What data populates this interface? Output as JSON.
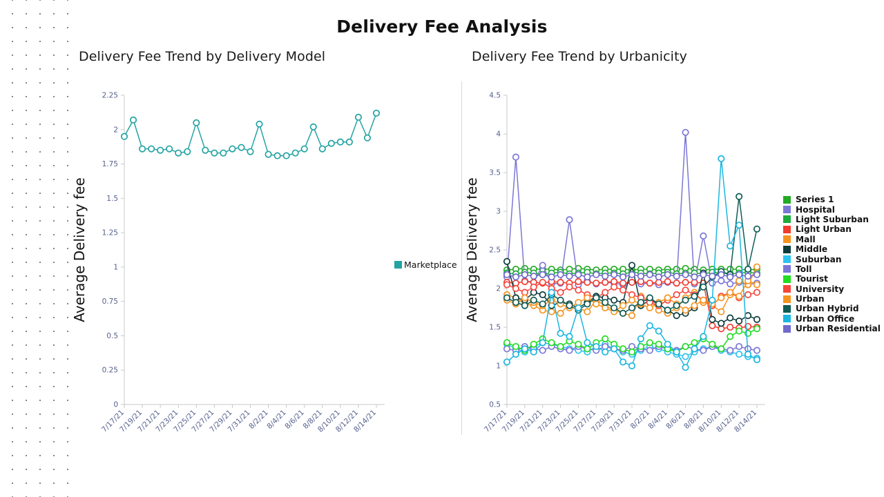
{
  "page": {
    "title": "Delivery Fee Analysis",
    "background": "#ffffff",
    "decoration": "dot-grid-left-margin"
  },
  "panels": {
    "left": {
      "title": "Delivery Fee Trend by Delivery Model",
      "legend_label": "Marketplace",
      "legend_color": "#23a3a3"
    },
    "right": {
      "title": "Delivery Fee Trend by Urbanicity"
    }
  },
  "chart_data": [
    {
      "id": "left",
      "type": "line",
      "title": "Delivery Fee Trend by Delivery Model",
      "xlabel": "",
      "ylabel": "Average Delivery fee",
      "ylim": [
        0,
        2.25
      ],
      "yticks": [
        0,
        0.25,
        0.5,
        0.75,
        1,
        1.25,
        1.5,
        1.75,
        2,
        2.25
      ],
      "ytick_labels": [
        "0",
        "0.25",
        "0.5",
        "0.75",
        "1",
        "1.25",
        "1.5",
        "1.75",
        "2",
        "2.25"
      ],
      "grid": false,
      "legend_position": "right",
      "xtick_labels": [
        "7/17/21",
        "7/19/21",
        "7/21/21",
        "7/23/21",
        "7/25/21",
        "7/27/21",
        "7/29/21",
        "7/31/21",
        "8/2/21",
        "8/4/21",
        "8/6/21",
        "8/8/21",
        "8/10/21",
        "8/12/21",
        "8/14/21"
      ],
      "x": [
        "7/17/21",
        "7/18/21",
        "7/19/21",
        "7/20/21",
        "7/21/21",
        "7/22/21",
        "7/23/21",
        "7/24/21",
        "7/25/21",
        "7/26/21",
        "7/27/21",
        "7/28/21",
        "7/29/21",
        "7/30/21",
        "7/31/21",
        "8/1/21",
        "8/2/21",
        "8/3/21",
        "8/4/21",
        "8/5/21",
        "8/6/21",
        "8/7/21",
        "8/8/21",
        "8/9/21",
        "8/10/21",
        "8/11/21",
        "8/12/21",
        "8/13/21",
        "8/14/21"
      ],
      "series": [
        {
          "name": "Marketplace",
          "color": "#23a3a3",
          "values": [
            1.95,
            2.07,
            1.86,
            1.86,
            1.85,
            1.86,
            1.83,
            1.84,
            2.05,
            1.85,
            1.83,
            1.83,
            1.86,
            1.87,
            1.84,
            2.04,
            1.82,
            1.81,
            1.81,
            1.83,
            1.86,
            2.02,
            1.86,
            1.9,
            1.91,
            1.91,
            2.09,
            1.94,
            2.12
          ]
        }
      ]
    },
    {
      "id": "right",
      "type": "line",
      "title": "Delivery Fee Trend by Urbanicity",
      "xlabel": "",
      "ylabel": "Average Delivery fee",
      "ylim": [
        0.5,
        4.5
      ],
      "yticks": [
        0.5,
        1,
        1.5,
        2,
        2.5,
        3,
        3.5,
        4,
        4.5
      ],
      "ytick_labels": [
        "0.5",
        "1",
        "1.5",
        "2",
        "2.5",
        "3",
        "3.5",
        "4",
        "4.5"
      ],
      "grid": false,
      "legend_position": "right",
      "xtick_labels": [
        "7/17/21",
        "7/19/21",
        "7/21/21",
        "7/23/21",
        "7/25/21",
        "7/27/21",
        "7/29/21",
        "7/31/21",
        "8/2/21",
        "8/4/21",
        "8/6/21",
        "8/8/21",
        "8/10/21",
        "8/12/21",
        "8/14/21"
      ],
      "x": [
        "7/17/21",
        "7/18/21",
        "7/19/21",
        "7/20/21",
        "7/21/21",
        "7/22/21",
        "7/23/21",
        "7/24/21",
        "7/25/21",
        "7/26/21",
        "7/27/21",
        "7/28/21",
        "7/29/21",
        "7/30/21",
        "7/31/21",
        "8/1/21",
        "8/2/21",
        "8/3/21",
        "8/4/21",
        "8/5/21",
        "8/6/21",
        "8/7/21",
        "8/8/21",
        "8/9/21",
        "8/10/21",
        "8/11/21",
        "8/12/21",
        "8/13/21",
        "8/14/21"
      ],
      "series": [
        {
          "name": "Series 1",
          "color": "#22aa22",
          "values": [
            2.24,
            2.25,
            2.26,
            2.25,
            2.25,
            2.25,
            2.24,
            2.25,
            2.26,
            2.25,
            2.24,
            2.25,
            2.25,
            2.25,
            2.24,
            2.25,
            2.25,
            2.24,
            2.25,
            2.25,
            2.26,
            2.25,
            2.24,
            2.25,
            2.25,
            2.25,
            2.25,
            2.24,
            2.25
          ]
        },
        {
          "name": "Hospital",
          "color": "#7b76d6",
          "values": [
            2.15,
            3.7,
            2.1,
            2.08,
            2.3,
            2.06,
            2.07,
            2.89,
            2.05,
            2.1,
            2.06,
            2.08,
            2.07,
            2.05,
            2.08,
            2.06,
            2.07,
            2.05,
            2.08,
            2.07,
            4.02,
            2.06,
            2.68,
            2.07,
            2.1,
            2.06,
            2.08,
            2.05,
            2.07
          ]
        },
        {
          "name": "Light Suburban",
          "color": "#1faa3c",
          "values": [
            2.2,
            2.19,
            2.21,
            2.2,
            2.18,
            2.2,
            2.21,
            2.19,
            2.2,
            2.21,
            2.19,
            2.2,
            2.2,
            2.19,
            2.21,
            2.2,
            2.19,
            2.2,
            2.21,
            2.19,
            2.2,
            2.2,
            2.19,
            2.21,
            2.2,
            2.19,
            2.2,
            2.21,
            2.2
          ]
        },
        {
          "name": "Light Urban",
          "color": "#f33b2e",
          "values": [
            2.08,
            2.07,
            2.09,
            2.08,
            2.07,
            2.09,
            2.08,
            2.07,
            2.09,
            2.08,
            2.07,
            2.08,
            2.09,
            2.07,
            2.08,
            2.09,
            2.07,
            2.08,
            2.09,
            2.07,
            2.08,
            2.08,
            2.07,
            1.52,
            1.48,
            1.5,
            1.49,
            1.51,
            1.5
          ]
        },
        {
          "name": "Mall",
          "color": "#f6931e",
          "values": [
            1.92,
            1.88,
            1.8,
            1.78,
            1.72,
            1.7,
            1.68,
            1.8,
            1.75,
            1.7,
            1.85,
            1.78,
            1.72,
            1.68,
            1.65,
            1.9,
            1.85,
            1.72,
            1.68,
            1.75,
            1.88,
            1.95,
            1.82,
            1.78,
            1.7,
            1.92,
            2.1,
            2.05,
            2.28
          ]
        },
        {
          "name": "Middle",
          "color": "#0d3b3b",
          "values": [
            2.35,
            1.88,
            1.85,
            1.95,
            1.92,
            1.78,
            1.82,
            1.8,
            1.75,
            1.82,
            1.9,
            1.88,
            1.85,
            1.82,
            2.3,
            1.78,
            1.85,
            1.8,
            1.72,
            1.65,
            1.68,
            1.75,
            2.2,
            1.6,
            1.55,
            1.62,
            1.58,
            1.65,
            1.6
          ]
        },
        {
          "name": "Suburban",
          "color": "#2bc3f0",
          "values": [
            1.28,
            1.22,
            1.18,
            1.25,
            1.3,
            1.28,
            1.25,
            1.22,
            1.2,
            1.18,
            1.25,
            1.28,
            1.22,
            1.18,
            1.15,
            1.2,
            1.25,
            1.22,
            1.18,
            1.15,
            1.12,
            1.18,
            1.22,
            1.25,
            1.2,
            1.18,
            1.15,
            1.12,
            1.1
          ]
        },
        {
          "name": "Toll",
          "color": "#7b76d6",
          "values": [
            1.22,
            1.2,
            1.25,
            1.22,
            1.2,
            1.25,
            1.22,
            1.2,
            1.25,
            1.22,
            1.2,
            1.25,
            1.22,
            1.2,
            1.25,
            1.22,
            1.2,
            1.25,
            1.22,
            1.2,
            1.25,
            1.22,
            1.2,
            1.25,
            1.22,
            1.2,
            1.25,
            1.22,
            1.2
          ]
        },
        {
          "name": "Tourist",
          "color": "#21dd21",
          "values": [
            1.3,
            1.25,
            1.2,
            1.28,
            1.35,
            1.3,
            1.25,
            1.32,
            1.28,
            1.22,
            1.3,
            1.35,
            1.28,
            1.22,
            1.18,
            1.25,
            1.3,
            1.28,
            1.22,
            1.18,
            1.25,
            1.3,
            1.35,
            1.28,
            1.22,
            1.38,
            1.45,
            1.42,
            1.48
          ]
        },
        {
          "name": "University",
          "color": "#f7463c",
          "values": [
            2.05,
            2.0,
            1.95,
            2.02,
            2.08,
            2.0,
            1.95,
            2.02,
            1.98,
            1.92,
            1.88,
            1.95,
            2.02,
            1.98,
            1.92,
            1.88,
            1.82,
            1.78,
            1.85,
            1.92,
            1.98,
            1.92,
            1.85,
            1.78,
            1.9,
            1.95,
            1.88,
            1.92,
            1.95
          ]
        },
        {
          "name": "Urban",
          "color": "#f79420",
          "values": [
            1.85,
            1.8,
            1.88,
            1.82,
            1.78,
            1.85,
            1.8,
            1.75,
            1.82,
            1.88,
            1.8,
            1.75,
            1.7,
            1.78,
            1.85,
            1.8,
            1.75,
            1.82,
            1.88,
            1.8,
            1.72,
            1.78,
            1.85,
            1.8,
            1.88,
            1.95,
            1.9,
            2.1,
            2.05
          ]
        },
        {
          "name": "Urban Hybrid",
          "color": "#0e5c55",
          "values": [
            1.88,
            1.82,
            1.78,
            1.85,
            1.8,
            1.92,
            1.85,
            1.78,
            1.72,
            1.8,
            1.88,
            1.82,
            1.75,
            1.68,
            1.75,
            1.82,
            1.88,
            1.8,
            1.72,
            1.78,
            1.85,
            1.9,
            2.02,
            2.15,
            2.22,
            2.18,
            3.19,
            2.25,
            2.77
          ]
        },
        {
          "name": "Urban Office",
          "color": "#1ab6e0",
          "values": [
            1.05,
            1.15,
            1.22,
            1.18,
            1.3,
            1.95,
            1.42,
            1.38,
            1.75,
            1.3,
            1.25,
            1.18,
            1.22,
            1.05,
            1.0,
            1.35,
            1.52,
            1.45,
            1.28,
            1.18,
            0.98,
            1.22,
            1.38,
            1.85,
            3.68,
            2.55,
            2.82,
            1.15,
            1.08
          ]
        },
        {
          "name": "Urban Residential",
          "color": "#6f6acb",
          "values": [
            2.18,
            2.15,
            2.18,
            2.16,
            2.18,
            2.15,
            2.18,
            2.16,
            2.18,
            2.15,
            2.18,
            2.16,
            2.18,
            2.15,
            2.18,
            2.16,
            2.18,
            2.15,
            2.18,
            2.16,
            2.18,
            2.15,
            2.18,
            2.16,
            2.18,
            2.15,
            2.18,
            2.16,
            2.18
          ]
        }
      ]
    }
  ]
}
